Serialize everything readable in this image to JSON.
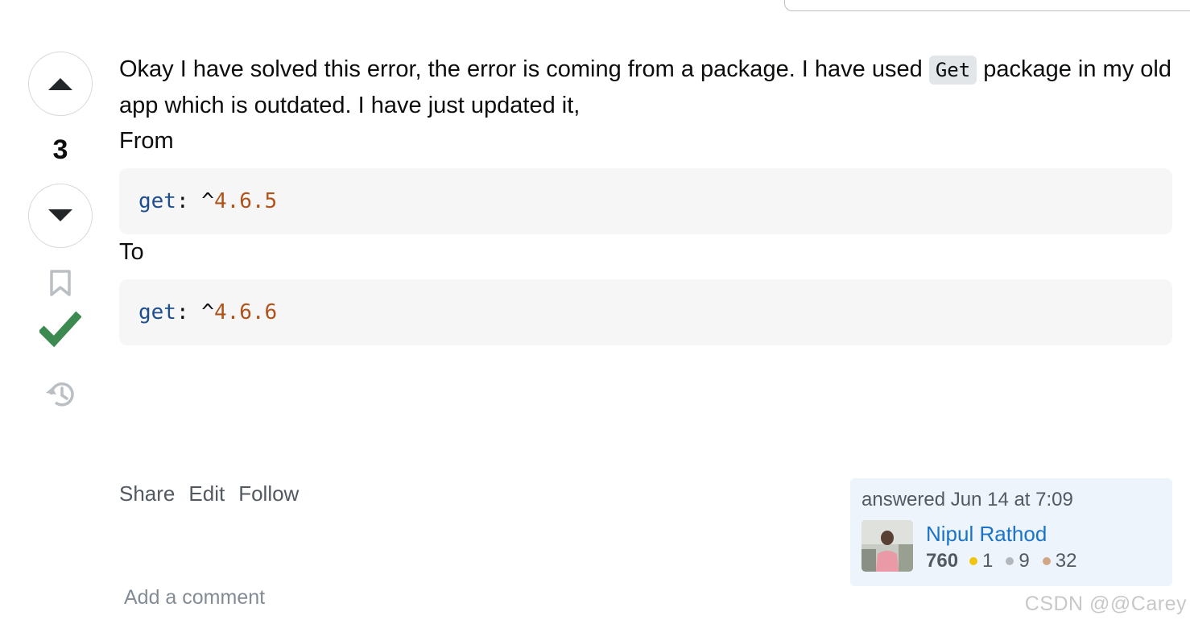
{
  "vote": {
    "count": "3",
    "upvote_label": "Up vote",
    "downvote_label": "Down vote"
  },
  "post": {
    "intro_before": "Okay I have solved this error, the error is coming from a package. I have used ",
    "inline_code": "Get",
    "intro_after": " package in my old app which is outdated. I have just updated it,",
    "from_label": "From",
    "to_label": "To",
    "code_from": {
      "key": "get",
      "punct": ": ^",
      "version": "4.6.5"
    },
    "code_to": {
      "key": "get",
      "punct": ": ^",
      "version": "4.6.6"
    }
  },
  "menu": {
    "share": "Share",
    "edit": "Edit",
    "follow": "Follow"
  },
  "user": {
    "action": "answered Jun 14 at 7:09",
    "name": "Nipul Rathod",
    "reputation": "760",
    "gold": "1",
    "silver": "9",
    "bronze": "32"
  },
  "comment": {
    "add_label": "Add a comment"
  },
  "watermark": "CSDN @@Carey",
  "colors": {
    "accepted": "#3d8a50",
    "link": "#1a73c9",
    "gold": "#f1c40f",
    "silver": "#b4b8bc",
    "bronze": "#d1a684",
    "card_bg": "#edf4fc"
  }
}
